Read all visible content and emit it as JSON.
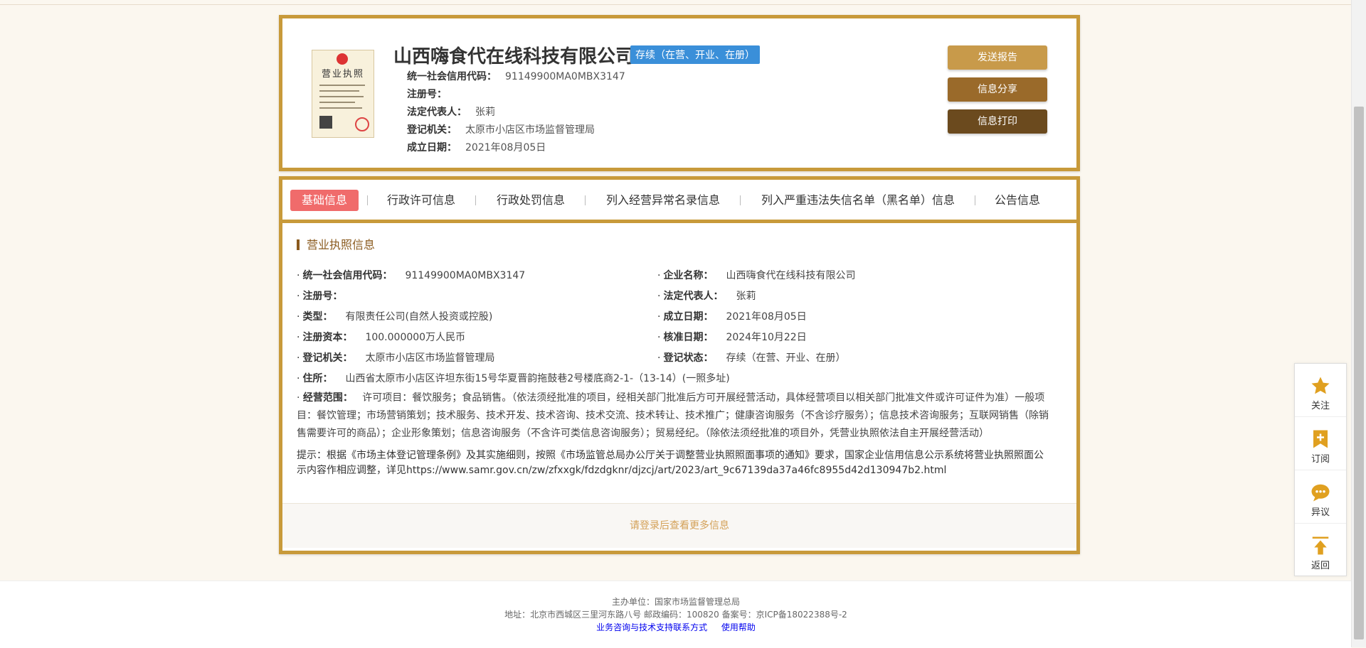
{
  "company": {
    "name": "山西嗨食代在线科技有限公司",
    "status": "存续（在营、开业、在册）",
    "info": [
      {
        "label": "统一社会信用代码：",
        "value": "91149900MA0MBX3147"
      },
      {
        "label": "注册号：",
        "value": ""
      },
      {
        "label": "法定代表人：",
        "value": "张莉"
      },
      {
        "label": "登记机关：",
        "value": "太原市小店区市场监督管理局"
      },
      {
        "label": "成立日期：",
        "value": "2021年08月05日"
      }
    ],
    "license_image_label": "营业执照"
  },
  "actions": {
    "send_report": "发送报告",
    "share": "信息分享",
    "print": "信息打印"
  },
  "tabs": [
    {
      "label": "基础信息",
      "active": true
    },
    {
      "label": "行政许可信息"
    },
    {
      "label": "行政处罚信息"
    },
    {
      "label": "列入经营异常名录信息"
    },
    {
      "label": "列入严重违法失信名单（黑名单）信息"
    },
    {
      "label": "公告信息"
    }
  ],
  "basic": {
    "section_title": "营业执照信息",
    "left": [
      {
        "label": "统一社会信用代码：",
        "value": "91149900MA0MBX3147"
      },
      {
        "label": "注册号：",
        "value": ""
      },
      {
        "label": "类型：",
        "value": "有限责任公司(自然人投资或控股)"
      },
      {
        "label": "注册资本：",
        "value": "100.000000万人民币"
      },
      {
        "label": "登记机关：",
        "value": "太原市小店区市场监督管理局"
      },
      {
        "label": "住所：",
        "value": "山西省太原市小店区许坦东街15号华夏晋韵拖鼓巷2号楼底商2-1-（13-14）(一照多址)"
      }
    ],
    "right": [
      {
        "label": "企业名称：",
        "value": "山西嗨食代在线科技有限公司"
      },
      {
        "label": "法定代表人：",
        "value": "张莉"
      },
      {
        "label": "成立日期：",
        "value": "2021年08月05日"
      },
      {
        "label": "核准日期：",
        "value": "2024年10月22日"
      },
      {
        "label": "登记状态：",
        "value": "存续（在营、开业、在册）"
      }
    ],
    "scope_label": "经营范围：",
    "scope_value": "许可项目：餐饮服务；食品销售。（依法须经批准的项目，经相关部门批准后方可开展经营活动，具体经营项目以相关部门批准文件或许可证件为准）一般项目：餐饮管理；市场营销策划；技术服务、技术开发、技术咨询、技术交流、技术转让、技术推广；健康咨询服务（不含诊疗服务）；信息技术咨询服务；互联网销售（除销售需要许可的商品）；企业形象策划；信息咨询服务（不含许可类信息咨询服务）；贸易经纪。（除依法须经批准的项目外，凭营业执照依法自主开展经营活动）",
    "tip": "提示：根据《市场主体登记管理条例》及其实施细则，按照《市场监管总局办公厅关于调整营业执照照面事项的通知》要求，国家企业信用信息公示系统将营业执照照面公示内容作相应调整，详见https://www.samr.gov.cn/zw/zfxxgk/fdzdgknr/djzcj/art/2023/art_9c67139da37a46fc8955d42d130947b2.html",
    "login_more": "请登录后查看更多信息"
  },
  "sidebar": {
    "items": [
      {
        "label": "关注",
        "icon": "star-icon"
      },
      {
        "label": "订阅",
        "icon": "subscribe-icon"
      },
      {
        "label": "异议",
        "icon": "comment-icon"
      },
      {
        "label": "返回",
        "icon": "back-to-top-icon"
      }
    ]
  },
  "footer": {
    "sponsor": "主办单位：国家市场监督管理总局",
    "address": "地址：北京市西城区三里河东路八号   邮政编码：100820   备案号：京ICP备18022388号-2",
    "link_contact": "业务咨询与技术支持联系方式",
    "link_help": "使用帮助"
  },
  "colors": {
    "border_gold": "#c89a3a",
    "tab_active": "#f06b6b",
    "status_blue": "#3a8fd9",
    "icon_gold": "#e0a020"
  }
}
